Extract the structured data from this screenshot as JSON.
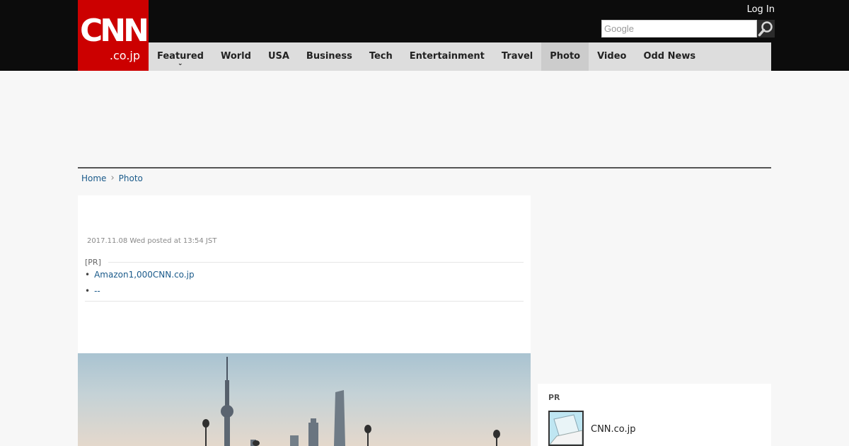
{
  "header": {
    "logo_main": "CNN",
    "logo_sub": ".co.jp",
    "login_label": "Log In",
    "search_placeholder": "Google",
    "brand_color": "#cc0000"
  },
  "nav": {
    "items": [
      {
        "label": "Featured"
      },
      {
        "label": "World"
      },
      {
        "label": "USA"
      },
      {
        "label": "Business"
      },
      {
        "label": "Tech"
      },
      {
        "label": "Entertainment"
      },
      {
        "label": "Travel"
      },
      {
        "label": "Photo"
      },
      {
        "label": "Video"
      },
      {
        "label": "Odd News"
      }
    ],
    "active": "Photo"
  },
  "breadcrumb": {
    "home": "Home",
    "current": "Photo"
  },
  "article": {
    "timestamp": "2017.11.08 Wed posted at 13:54 JST",
    "pr_label": "[PR]",
    "pr_links": [
      {
        "text": "Amazon1,000CNN.co.jp"
      },
      {
        "text": "--"
      }
    ]
  },
  "sidebar": {
    "pr_title": "PR",
    "pr_item_text": "CNN.co.jp"
  }
}
